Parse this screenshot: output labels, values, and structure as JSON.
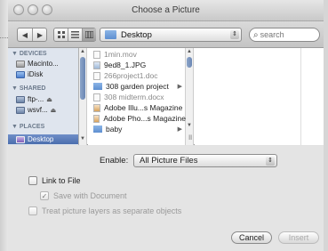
{
  "window": {
    "title": "Choose a Picture"
  },
  "toolbar": {
    "location": "Desktop",
    "search_placeholder": "search",
    "back_icon": "back-arrow-icon",
    "forward_icon": "forward-arrow-icon"
  },
  "sidebar": {
    "devices_header": "DEVICES",
    "devices": [
      {
        "label": "Macinto...",
        "icon": "hard-disk-icon"
      },
      {
        "label": "iDisk",
        "icon": "idisk-icon"
      }
    ],
    "shared_header": "SHARED",
    "shared": [
      {
        "label": "ftp-...",
        "icon": "network-computer-icon"
      },
      {
        "label": "wsvf...",
        "icon": "network-computer-icon"
      }
    ],
    "places_header": "PLACES",
    "places": [
      {
        "label": "Desktop",
        "icon": "desktop-icon",
        "selected": true
      }
    ]
  },
  "files": [
    {
      "name": "1min.mov",
      "dim": true,
      "folder": false
    },
    {
      "name": "9ed8_1.JPG",
      "dim": false,
      "folder": false
    },
    {
      "name": "266project1.doc",
      "dim": true,
      "folder": false
    },
    {
      "name": "308 garden project",
      "dim": false,
      "folder": true
    },
    {
      "name": "308 midterm.docx",
      "dim": true,
      "folder": false
    },
    {
      "name": "Adobe Illu...s Magazine",
      "dim": false,
      "folder": false
    },
    {
      "name": "Adobe Pho...s Magazine",
      "dim": false,
      "folder": false
    },
    {
      "name": "baby",
      "dim": false,
      "folder": true
    }
  ],
  "options": {
    "enable_label": "Enable:",
    "enable_value": "All Picture Files",
    "link_to_file": "Link to File",
    "save_with_document": "Save with Document",
    "treat_layers": "Treat picture layers as separate objects"
  },
  "buttons": {
    "cancel": "Cancel",
    "insert": "Insert"
  },
  "colors": {
    "selection": "#5a7bbd",
    "sidebar_bg": "#dfe5ee",
    "folder": "#6f9bd8"
  }
}
